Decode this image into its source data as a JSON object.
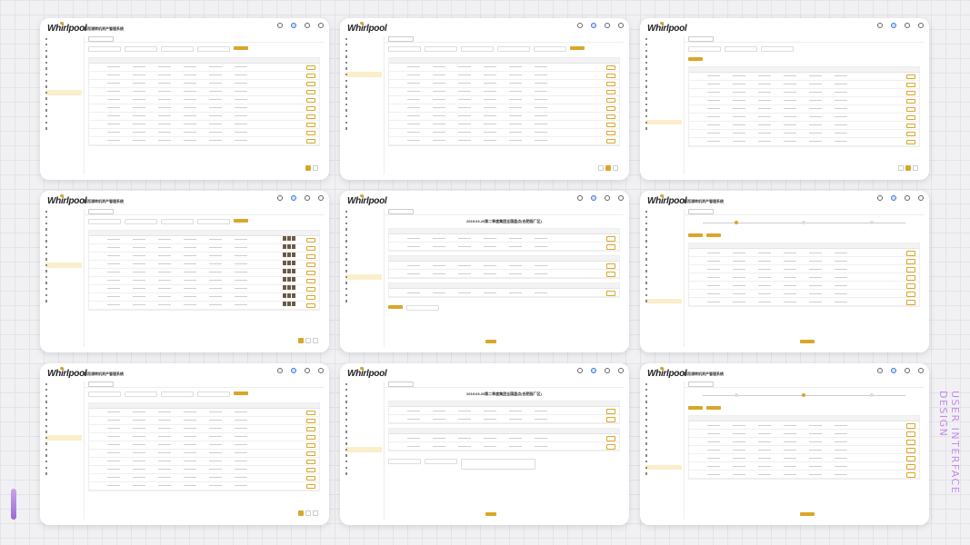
{
  "logo_text": "Whirlpool",
  "system_title": "惠而浦转机资产管理系统",
  "side_caption": "USER INTERFACE DESIGN",
  "doc_title_a": "2019.03.20第二季度集团全国盘点(合肥园厂区)",
  "doc_title_b": "2019.03.20第二季度集团全国盘点(合肥园厂区)",
  "colors": {
    "accent": "#d9a628",
    "caption": "#c58ae6",
    "background": "#f1f1f4"
  }
}
